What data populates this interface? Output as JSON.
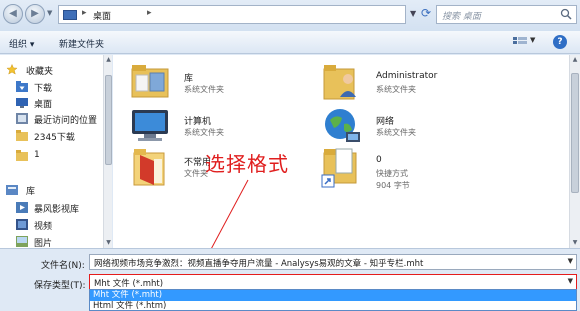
{
  "address_bar": {
    "path_root": "桌面",
    "search_placeholder": "搜索 桌面"
  },
  "toolbar": {
    "organize_label": "组织 ▾",
    "new_folder_label": "新建文件夹"
  },
  "nav_pane": {
    "favorites_label": "收藏夹",
    "favorites": [
      "下载",
      "桌面",
      "最近访问的位置",
      "2345下载",
      "1"
    ],
    "libraries_label": "库",
    "libraries": [
      "暴风影视库",
      "视频",
      "图片"
    ]
  },
  "content": {
    "items": [
      {
        "name": "库",
        "type": "系统文件夹",
        "extra": "",
        "icon": "library-icon"
      },
      {
        "name": "Administrator",
        "type": "系统文件夹",
        "extra": "",
        "icon": "user-folder-icon"
      },
      {
        "name": "计算机",
        "type": "系统文件夹",
        "extra": "",
        "icon": "computer-icon"
      },
      {
        "name": "网络",
        "type": "系统文件夹",
        "extra": "",
        "icon": "network-icon"
      },
      {
        "name": "不常用",
        "type": "文件夹",
        "extra": "",
        "icon": "folder-icon"
      },
      {
        "name": "0",
        "type": "快捷方式",
        "extra": "904 字节",
        "icon": "shortcut-icon"
      }
    ]
  },
  "annotation": {
    "text": "选择格式",
    "color": "#e01e1e"
  },
  "form": {
    "filename_label": "文件名(N):",
    "filename_value": "网络视频市场竞争激烈：视频直播争夺用户流量 - Analysys易观的文章 - 知乎专栏.mht",
    "filetype_label": "保存类型(T):",
    "filetype_value": "Mht 文件 (*.mht)",
    "filetype_options": [
      "Mht 文件 (*.mht)",
      "Html 文件 (*.htm)"
    ]
  }
}
